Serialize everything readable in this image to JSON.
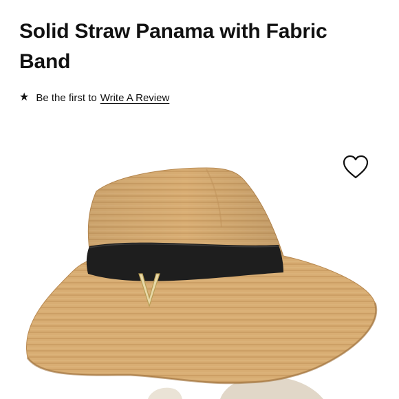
{
  "product": {
    "title": "Solid Straw Panama with Fabric Band"
  },
  "reviews": {
    "star_icon": "star-icon",
    "prompt_text": "Be the first to",
    "link_text": "Write A Review"
  },
  "wishlist": {
    "icon": "heart-outline-icon"
  },
  "colors": {
    "text": "#111111",
    "straw": "#d8ad73",
    "band": "#1e1e1e",
    "background": "#ffffff"
  }
}
